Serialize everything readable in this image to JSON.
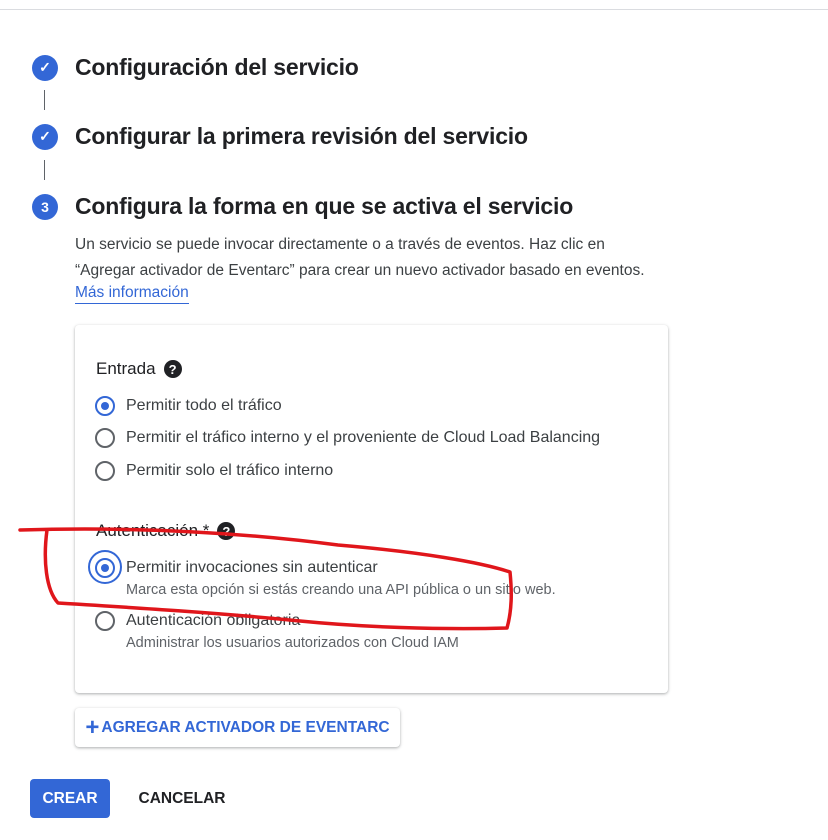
{
  "steps": [
    {
      "marker": "✓",
      "title": "Configuración del servicio"
    },
    {
      "marker": "✓",
      "title": "Configurar la primera revisión del servicio"
    },
    {
      "marker": "3",
      "title": "Configura la forma en que se activa el servicio"
    }
  ],
  "description": {
    "line1": "Un servicio se puede invocar directamente o a través de eventos. Haz clic en",
    "line2": "“Agregar activador de Eventarc” para crear un nuevo activador basado en eventos.",
    "link": "Más información"
  },
  "ingress": {
    "label": "Entrada",
    "options": [
      {
        "label": "Permitir todo el tráfico",
        "selected": true
      },
      {
        "label": "Permitir el tráfico interno y el proveniente de Cloud Load Balancing",
        "selected": false
      },
      {
        "label": "Permitir solo el tráfico interno",
        "selected": false
      }
    ]
  },
  "auth": {
    "label": "Autenticación *",
    "options": [
      {
        "label": "Permitir invocaciones sin autenticar",
        "sub": "Marca esta opción si estás creando una API pública o un sitio web.",
        "selected": true
      },
      {
        "label": "Autenticación obligatoria",
        "sub": "Administrar los usuarios autorizados con Cloud IAM",
        "selected": false
      }
    ]
  },
  "buttons": {
    "add_trigger": "AGREGAR ACTIVADOR DE EVENTARC",
    "create": "CREAR",
    "cancel": "CANCELAR"
  },
  "icons": {
    "step_done": "check-circle-icon",
    "help": "help-circle-icon",
    "add": "plus-icon"
  },
  "colors": {
    "accent": "#3367d6",
    "annotation": "#e0161b"
  }
}
